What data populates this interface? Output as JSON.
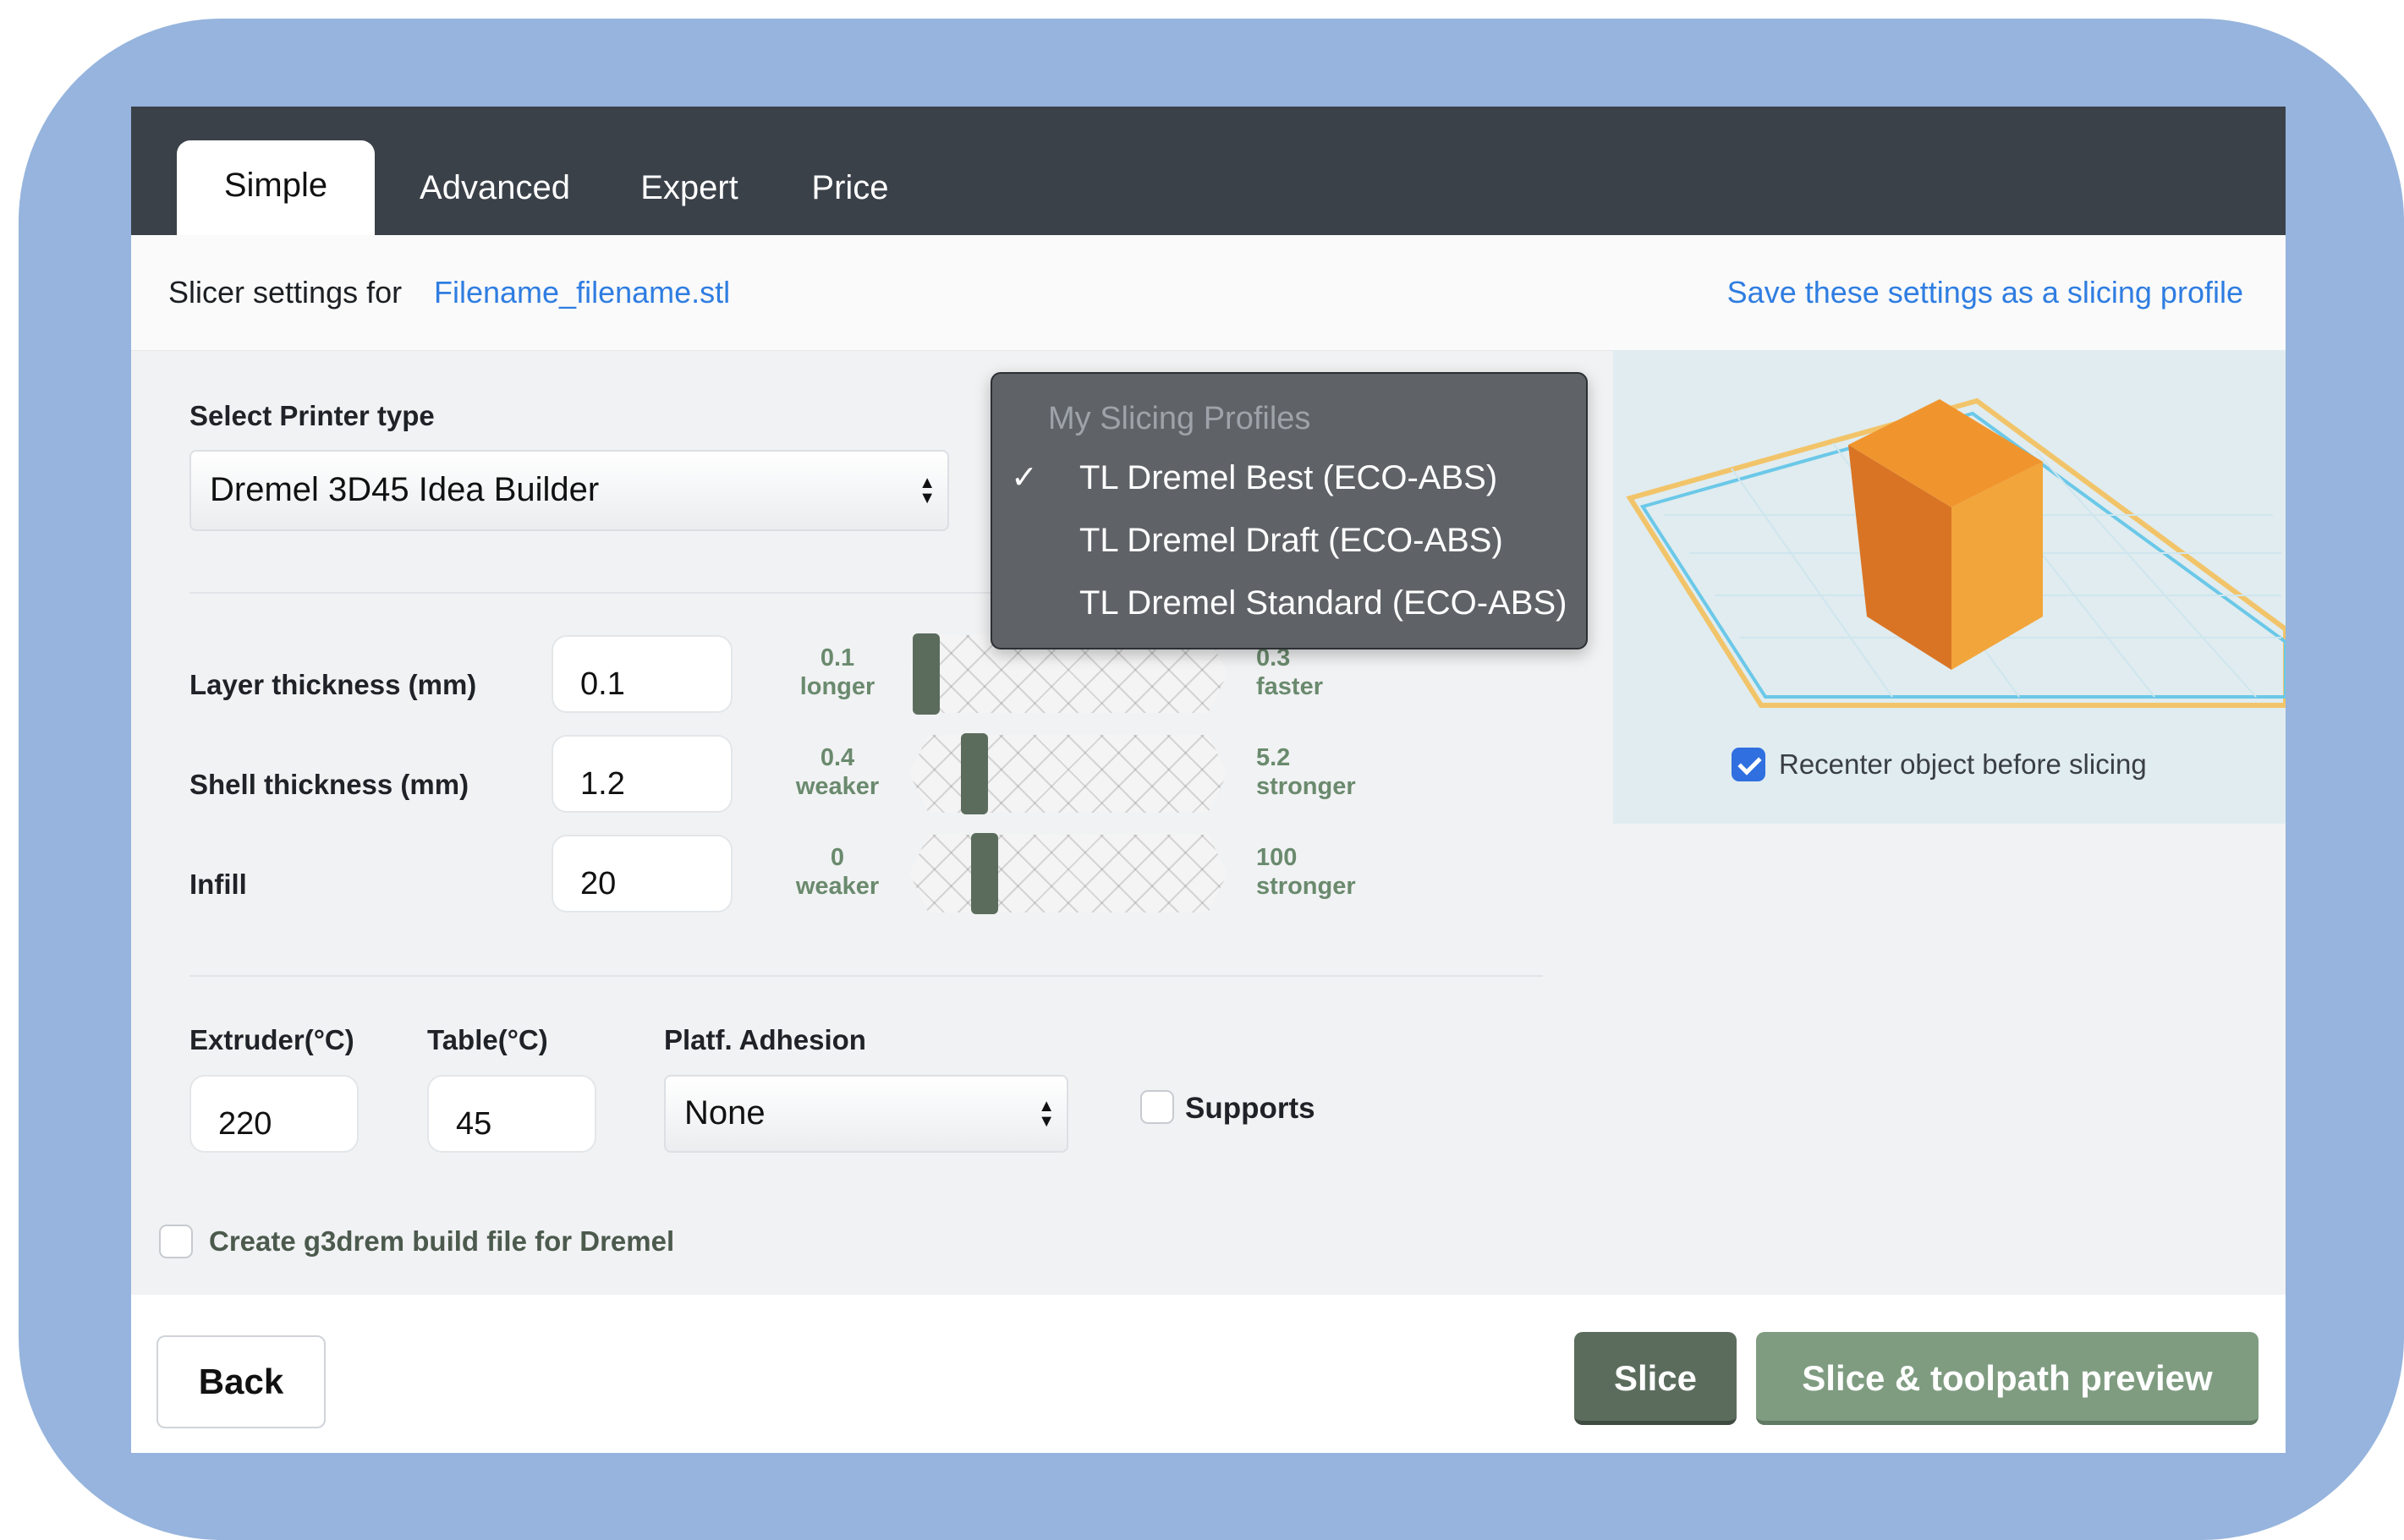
{
  "tabs": [
    {
      "label": "Simple"
    },
    {
      "label": "Advanced"
    },
    {
      "label": "Expert"
    },
    {
      "label": "Price"
    }
  ],
  "header": {
    "prefix": "Slicer settings for",
    "filename": "Filename_filename.stl",
    "save_link": "Save these settings as a slicing profile"
  },
  "printer": {
    "label": "Select Printer type",
    "value": "Dremel 3D45 Idea Builder"
  },
  "profiles": {
    "heading": "My Slicing Profiles",
    "items": [
      {
        "label": "TL Dremel Best (ECO-ABS)",
        "selected": true
      },
      {
        "label": "TL Dremel Draft (ECO-ABS)",
        "selected": false
      },
      {
        "label": "TL Dremel Standard (ECO-ABS)",
        "selected": false
      }
    ]
  },
  "params": [
    {
      "label": "Layer thickness (mm)",
      "value": "0.1",
      "min_val": "0.1",
      "min_txt": "longer",
      "max_val": "0.3",
      "max_txt": "faster",
      "level": 0.0
    },
    {
      "label": "Shell thickness (mm)",
      "value": "1.2",
      "min_val": "0.4",
      "min_txt": "weaker",
      "max_val": "5.2",
      "max_txt": "stronger",
      "level": 0.17
    },
    {
      "label": "Infill",
      "value": "20",
      "min_val": "0",
      "min_txt": "weaker",
      "max_val": "100",
      "max_txt": "stronger",
      "level": 0.2
    }
  ],
  "temps": {
    "extruder_label": "Extruder(°C)",
    "extruder_value": "220",
    "table_label": "Table(°C)",
    "table_value": "45",
    "adhesion_label": "Platf. Adhesion",
    "adhesion_value": "None",
    "supports_label": "Supports",
    "supports_checked": false
  },
  "g3drem": {
    "label": "Create g3drem build file for Dremel",
    "checked": false
  },
  "preview": {
    "recenter_label": "Recenter object before slicing",
    "recenter_checked": true,
    "cube_colors": {
      "top": "#f0952e",
      "left": "#d97425",
      "right": "#f2a53a"
    },
    "bed_colors": {
      "outer": "#f2c46a",
      "inner": "#6bc8e8"
    }
  },
  "buttons": {
    "back": "Back",
    "slice": "Slice",
    "slice_preview": "Slice & toolpath preview"
  },
  "colors": {
    "link": "#2f7de1",
    "dark_bar": "#3b4149",
    "green_dark": "#5b6c5d",
    "green_light": "#7f9c81",
    "frame": "#96b4dd"
  }
}
